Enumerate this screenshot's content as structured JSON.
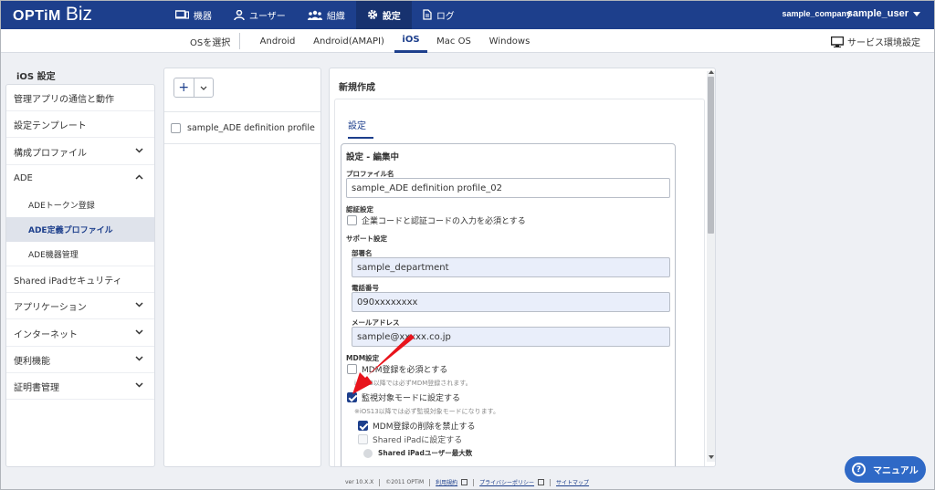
{
  "header": {
    "logo_main": "OPTiM",
    "logo_sub": "Biz",
    "nav": [
      {
        "label": "機器",
        "icon": "device-icon"
      },
      {
        "label": "ユーザー",
        "icon": "user-icon"
      },
      {
        "label": "組織",
        "icon": "group-icon"
      },
      {
        "label": "設定",
        "icon": "gear-icon",
        "active": true
      },
      {
        "label": "ログ",
        "icon": "document-icon"
      }
    ],
    "company": "sample_company",
    "user": "sample_user"
  },
  "os_bar": {
    "select_label": "OSを選択",
    "tabs": [
      "Android",
      "Android(AMAPI)",
      "iOS",
      "Mac OS",
      "Windows"
    ],
    "active_tab": "iOS",
    "service_settings": "サービス環境設定"
  },
  "sidebar": {
    "title": "iOS 設定",
    "items": [
      {
        "label": "管理アプリの通信と動作"
      },
      {
        "label": "設定テンプレート"
      },
      {
        "label": "構成プロファイル",
        "chevron": "down"
      },
      {
        "label": "ADE",
        "chevron": "up"
      },
      {
        "label": "ADEトークン登録"
      },
      {
        "label": "ADE定義プロファイル",
        "active": true
      },
      {
        "label": "ADE機器管理"
      },
      {
        "label": "Shared iPadセキュリティ"
      },
      {
        "label": "アプリケーション",
        "chevron": "down"
      },
      {
        "label": "インターネット",
        "chevron": "down"
      },
      {
        "label": "便利機能",
        "chevron": "down"
      },
      {
        "label": "証明書管理",
        "chevron": "down"
      }
    ]
  },
  "profile_list": {
    "add_label": "+",
    "items": [
      "sample_ADE definition profile"
    ]
  },
  "editor": {
    "title": "新規作成",
    "tab": "設定",
    "box_title": "設定 - 編集中",
    "profile_name_label": "プロファイル名",
    "profile_name_value": "sample_ADE definition profile_02",
    "auth_label": "認証設定",
    "auth_checkbox": "企業コードと認証コードの入力を必須とする",
    "support_label": "サポート設定",
    "department_label": "部署名",
    "department_value": "sample_department",
    "phone_label": "電話番号",
    "phone_value": "090xxxxxxxx",
    "email_label": "メールアドレス",
    "email_value": "sample@xxxxx.co.jp",
    "mdm_label": "MDM設定",
    "mdm_required": "MDM登録を必須とする",
    "mdm_required_note": "iOS13以降では必ずMDM登録されます。",
    "supervised": "監視対象モードに設定する",
    "supervised_note": "※iOS13以降では必ず監視対象モードになります。",
    "prevent_removal": "MDM登録の削除を禁止する",
    "shared_ipad": "Shared iPadに設定する",
    "shared_ipad_max": "Shared iPadユーザー最大数"
  },
  "footer": {
    "version": "ver 10.X.X",
    "copyright": "©2011 OPTiM",
    "terms": "利用規約",
    "privacy": "プライバシーポリシー",
    "sitemap": "サイトマップ"
  },
  "manual_button": "マニュアル",
  "colors": {
    "brand": "#1d3f8c",
    "accent": "#2f69c6",
    "arrow": "#e8141c"
  }
}
